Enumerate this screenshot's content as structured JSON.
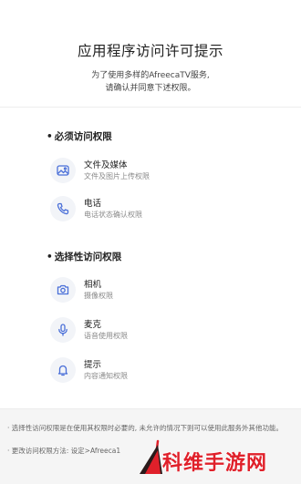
{
  "header": {
    "title": "应用程序访问许可提示",
    "subtitle_line1": "为了使用多样的AfreecaTV服务,",
    "subtitle_line2": "请确认并同意下述权限。"
  },
  "required_section": {
    "title": "必须访问权限",
    "items": [
      {
        "name": "文件及媒体",
        "desc": "文件及图片上传权限",
        "icon": "image-icon"
      },
      {
        "name": "电话",
        "desc": "电话状态确认权限",
        "icon": "phone-icon"
      }
    ]
  },
  "optional_section": {
    "title": "选择性访问权限",
    "items": [
      {
        "name": "相机",
        "desc": "摄像权限",
        "icon": "camera-icon"
      },
      {
        "name": "麦克",
        "desc": "语音使用权限",
        "icon": "microphone-icon"
      },
      {
        "name": "提示",
        "desc": "内容通知权限",
        "icon": "bell-icon"
      }
    ]
  },
  "footer": {
    "note1": "· 选择性访问权限是在使用其权限时必要的, 未允许的情况下则可以使用此服务外其他功能。",
    "note2": "· 更改访问权限方法: 设定>Afreeca1"
  },
  "watermark": {
    "text": "科维手游网"
  },
  "colors": {
    "icon_bg": "#f2f4f8",
    "icon_stroke": "#4a6fd8",
    "watermark_red": "#e0202a"
  }
}
